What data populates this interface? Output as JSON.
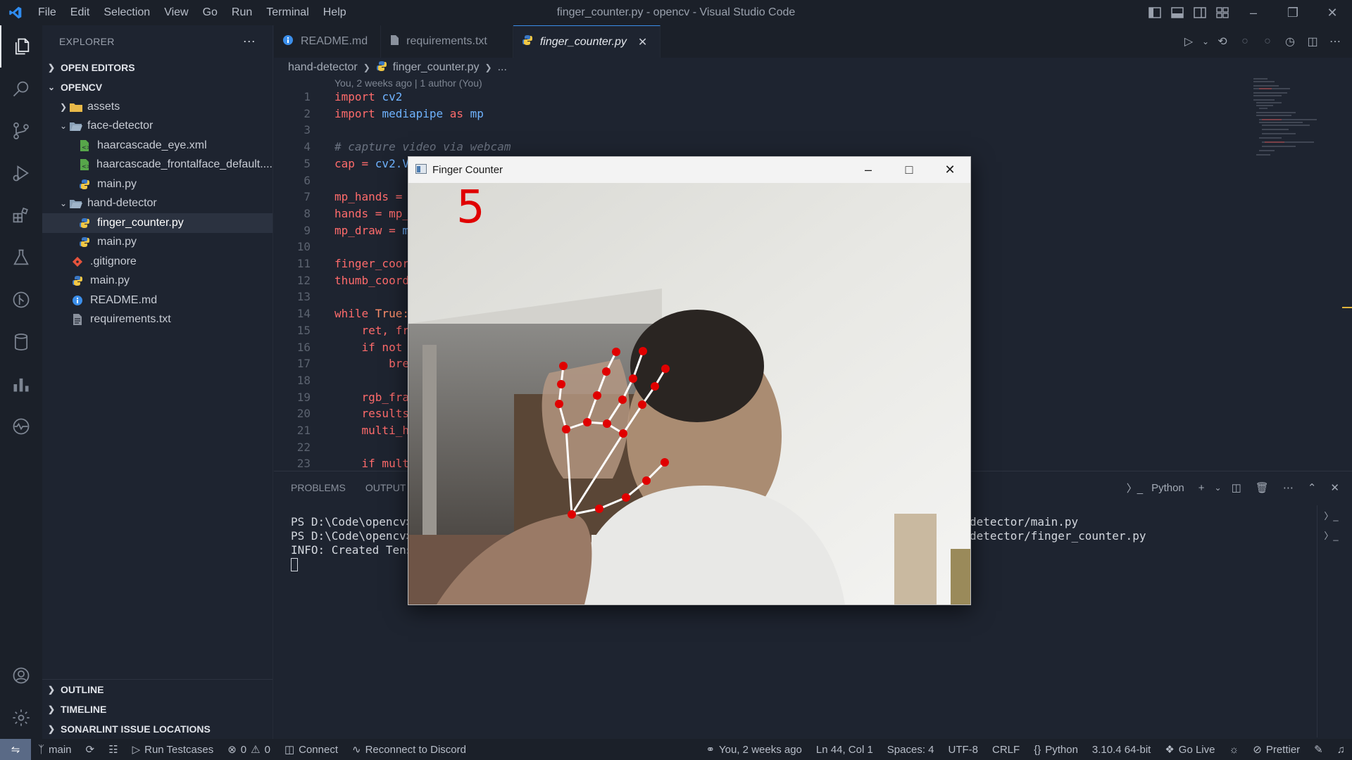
{
  "titlebar": {
    "menu": [
      "File",
      "Edit",
      "Selection",
      "View",
      "Go",
      "Run",
      "Terminal",
      "Help"
    ],
    "title": "finger_counter.py - opencv - Visual Studio Code"
  },
  "sidebar": {
    "header": "EXPLORER",
    "open_editors": "OPEN EDITORS",
    "root": "OPENCV",
    "tree": {
      "assets": "assets",
      "face_detector": "face-detector",
      "eye_xml": "haarcascade_eye.xml",
      "face_xml": "haarcascade_frontalface_default....",
      "face_main": "main.py",
      "hand_detector": "hand-detector",
      "finger_counter": "finger_counter.py",
      "hand_main": "main.py",
      "gitignore": ".gitignore",
      "root_main": "main.py",
      "readme": "README.md",
      "requirements": "requirements.txt"
    },
    "outline": "OUTLINE",
    "timeline": "TIMELINE",
    "sonarlint": "SONARLINT ISSUE LOCATIONS"
  },
  "tabs": [
    {
      "label": "README.md"
    },
    {
      "label": "requirements.txt"
    },
    {
      "label": "finger_counter.py"
    }
  ],
  "breadcrumb": {
    "folder": "hand-detector",
    "file": "finger_counter.py",
    "more": "..."
  },
  "codelens": "You, 2 weeks ago | 1 author (You)",
  "code": {
    "numbers": [
      "1",
      "2",
      "3",
      "4",
      "5",
      "6",
      "7",
      "8",
      "9",
      "10",
      "11",
      "12",
      "13",
      "14",
      "15",
      "16",
      "17",
      "18",
      "19",
      "20",
      "21",
      "22",
      "23"
    ],
    "l1a": "import ",
    "l1b": "cv2",
    "l2a": "import ",
    "l2b": "mediapipe",
    "l2c": " as ",
    "l2d": "mp",
    "l4": "# capture video via webcam",
    "l5a": "cap = ",
    "l5b": "cv2.V",
    "l7": "mp_hands =",
    "l8": "hands = mp_",
    "l9a": "mp_draw = ",
    "l9b": "m",
    "l11": "finger_coor",
    "l12": "thumb_coord",
    "l14a": "while ",
    "l14b": "True:",
    "l15": "    ret, fr",
    "l16a": "    if not",
    "l16b": "",
    "l17": "        bre",
    "l19": "    rgb_fra",
    "l20": "    results",
    "l21": "    multi_h",
    "l23": "    if mult"
  },
  "panel": {
    "problems": "PROBLEMS",
    "output": "OUTPUT",
    "terminal_name": "Python",
    "lines_left": [
      "PS D:\\Code\\opencv>",
      "PS D:\\Code\\opencv>",
      "INFO: Created Tens"
    ],
    "lines_right": [
      "detector/main.py",
      "detector/finger_counter.py"
    ]
  },
  "status": {
    "branch": "main",
    "run_testcases": "Run Testcases",
    "errors": "0",
    "warnings": "0",
    "connect": "Connect",
    "discord": "Reconnect to Discord",
    "blame": "You, 2 weeks ago",
    "position": "Ln 44, Col 1",
    "spaces": "Spaces: 4",
    "encoding": "UTF-8",
    "eol": "CRLF",
    "language": "Python",
    "interpreter": "3.10.4 64-bit",
    "golive": "Go Live",
    "prettier": "Prettier"
  },
  "finger_window": {
    "title": "Finger Counter",
    "count": "5"
  },
  "colors": {
    "accent": "#3b8eea",
    "landmark": "#e00000",
    "keyword": "#ff6b6b",
    "identifier": "#6fb3ff"
  }
}
